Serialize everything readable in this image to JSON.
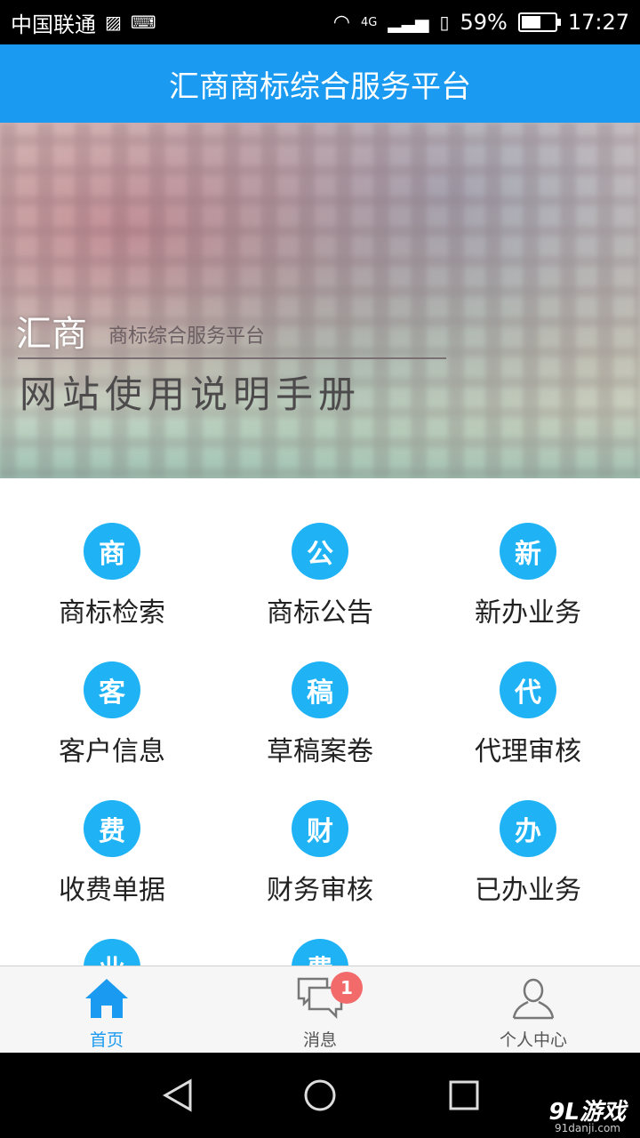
{
  "status_bar": {
    "carrier": "中国联通",
    "network": "4G",
    "battery_percent": "59%",
    "battery_level": 0.59,
    "time": "17:27"
  },
  "header": {
    "title": "汇商商标综合服务平台"
  },
  "banner": {
    "brand": "汇商",
    "brand_subtitle": "商标综合服务平台",
    "headline": "网站使用说明手册"
  },
  "menu": [
    {
      "icon_char": "商",
      "label": "商标检索"
    },
    {
      "icon_char": "公",
      "label": "商标公告"
    },
    {
      "icon_char": "新",
      "label": "新办业务"
    },
    {
      "icon_char": "客",
      "label": "客户信息"
    },
    {
      "icon_char": "稿",
      "label": "草稿案卷"
    },
    {
      "icon_char": "代",
      "label": "代理审核"
    },
    {
      "icon_char": "费",
      "label": "收费单据"
    },
    {
      "icon_char": "财",
      "label": "财务审核"
    },
    {
      "icon_char": "办",
      "label": "已办业务"
    },
    {
      "icon_char": "业",
      "label": ""
    },
    {
      "icon_char": "费",
      "label": ""
    }
  ],
  "tabs": [
    {
      "label": "首页",
      "icon": "home-icon",
      "active": true
    },
    {
      "label": "消息",
      "icon": "chat-icon",
      "badge": "1"
    },
    {
      "label": "个人中心",
      "icon": "person-icon"
    }
  ],
  "watermark": {
    "text": "9L游戏",
    "url_text": "91danji.com"
  },
  "colors": {
    "accent": "#1a9af0",
    "icon_circle": "#1fb3f5",
    "badge": "#f26a6a"
  }
}
